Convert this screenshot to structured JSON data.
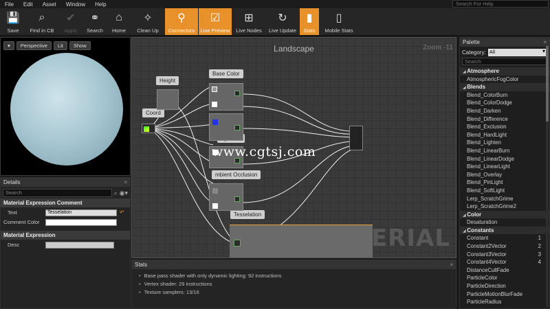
{
  "menu": [
    "File",
    "Edit",
    "Asset",
    "Window",
    "Help"
  ],
  "help_search_placeholder": "Search For Help",
  "toolbar": [
    {
      "label": "Save",
      "icon": "save-icon",
      "state": "normal"
    },
    {
      "label": "Find in CB",
      "icon": "find-in-cb-icon",
      "state": "normal"
    },
    {
      "label": "Apply",
      "icon": "apply-icon",
      "state": "disabled"
    },
    {
      "label": "Search",
      "icon": "search-icon",
      "state": "normal"
    },
    {
      "label": "Home",
      "icon": "home-icon",
      "state": "normal"
    },
    {
      "label": "Clean Up",
      "icon": "clean-up-icon",
      "state": "normal"
    },
    {
      "label": "Connectors",
      "icon": "connectors-icon",
      "state": "active"
    },
    {
      "label": "Live Preview",
      "icon": "live-preview-icon",
      "state": "active"
    },
    {
      "label": "Live Nodes",
      "icon": "live-nodes-icon",
      "state": "normal"
    },
    {
      "label": "Live Update",
      "icon": "live-update-icon",
      "state": "normal"
    },
    {
      "label": "Stats",
      "icon": "stats-icon",
      "state": "active"
    },
    {
      "label": "Mobile Stats",
      "icon": "mobile-stats-icon",
      "state": "normal"
    }
  ],
  "viewport": {
    "buttons": {
      "perspective": "Perspective",
      "lit": "Lit",
      "show": "Show"
    }
  },
  "details": {
    "tab_label": "Details",
    "search_placeholder": "Search",
    "sections": {
      "comment_title": "Material Expression Comment",
      "text_label": "Text",
      "text_value": "Tesselation",
      "comment_color_label": "Comment Color",
      "expression_title": "Material Expression",
      "desc_label": "Desc"
    }
  },
  "graph": {
    "title": "Landscape",
    "zoom": "Zoom -11",
    "watermark": "MATERIAL",
    "overlay_url": "www.cgtsj.com",
    "labels": {
      "height": "Height",
      "coord": "Coord",
      "base_color": "Base Color",
      "normal": "rmal",
      "roughness": "ughness",
      "ao": "mbient Occlusion",
      "tess": "Tesselation"
    }
  },
  "stats": {
    "tab_label": "Stats",
    "lines": [
      "Base pass shader with only dynamic lighting: 92 instructions",
      "Vertex shader: 29 instructions",
      "Texture samplers: 13/16"
    ]
  },
  "palette": {
    "tab_label": "Palette",
    "category_label": "Category:",
    "category_value": "All",
    "search_placeholder": "Search",
    "groups": [
      {
        "name": "Atmosphere",
        "items": [
          {
            "label": "AtmosphericFogColor",
            "shortcut": ""
          }
        ]
      },
      {
        "name": "Blends",
        "items": [
          {
            "label": "Blend_ColorBurn",
            "shortcut": ""
          },
          {
            "label": "Blend_ColorDodge",
            "shortcut": ""
          },
          {
            "label": "Blend_Darken",
            "shortcut": ""
          },
          {
            "label": "Blend_Difference",
            "shortcut": ""
          },
          {
            "label": "Blend_Exclusion",
            "shortcut": ""
          },
          {
            "label": "Blend_HardLight",
            "shortcut": ""
          },
          {
            "label": "Blend_Lighten",
            "shortcut": ""
          },
          {
            "label": "Blend_LinearBurn",
            "shortcut": ""
          },
          {
            "label": "Blend_LinearDodge",
            "shortcut": ""
          },
          {
            "label": "Blend_LinearLight",
            "shortcut": ""
          },
          {
            "label": "Blend_Overlay",
            "shortcut": ""
          },
          {
            "label": "Blend_PinLight",
            "shortcut": ""
          },
          {
            "label": "Blend_SoftLight",
            "shortcut": ""
          },
          {
            "label": "Lerp_ScratchGrime",
            "shortcut": ""
          },
          {
            "label": "Lerp_ScratchGrime2",
            "shortcut": ""
          }
        ]
      },
      {
        "name": "Color",
        "items": [
          {
            "label": "Desaturation",
            "shortcut": ""
          }
        ]
      },
      {
        "name": "Constants",
        "items": [
          {
            "label": "Constant",
            "shortcut": "1"
          },
          {
            "label": "Constant2Vector",
            "shortcut": "2"
          },
          {
            "label": "Constant3Vector",
            "shortcut": "3"
          },
          {
            "label": "Constant4Vector",
            "shortcut": "4"
          },
          {
            "label": "DistanceCullFade",
            "shortcut": ""
          },
          {
            "label": "ParticleColor",
            "shortcut": ""
          },
          {
            "label": "ParticleDirection",
            "shortcut": ""
          },
          {
            "label": "ParticleMotionBlurFade",
            "shortcut": ""
          },
          {
            "label": "ParticleRadius",
            "shortcut": ""
          }
        ]
      }
    ]
  },
  "colors": {
    "accent": "#e8902a",
    "background": "#1a1a1a",
    "graph": "#3a3a3a"
  }
}
